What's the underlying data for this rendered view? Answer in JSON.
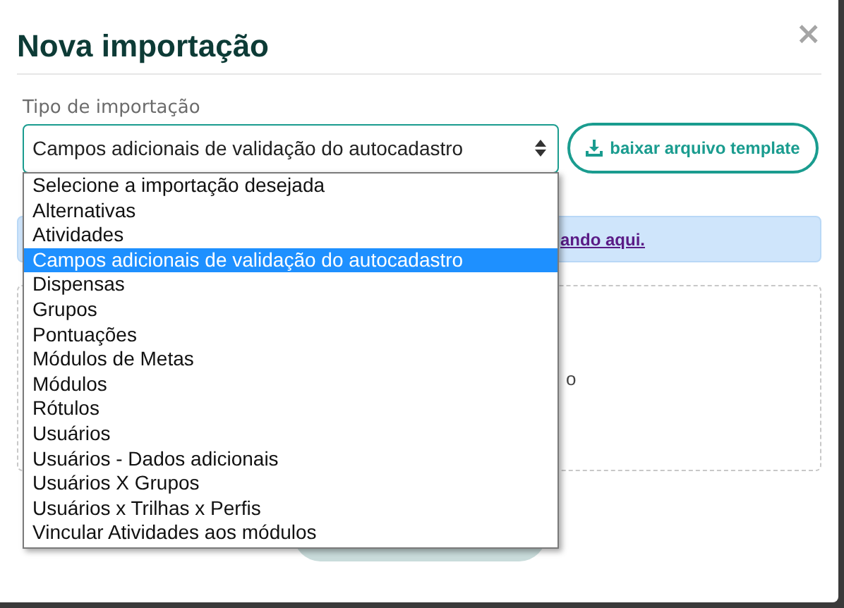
{
  "dialog": {
    "title": "Nova importação",
    "close": "×"
  },
  "import_type": {
    "label": "Tipo de importação",
    "value": "Campos adicionais de validação do autocadastro",
    "expanded": true
  },
  "template_button": {
    "label": "baixar arquivo template"
  },
  "options": [
    {
      "label": "Selecione a importação desejada",
      "selected": false
    },
    {
      "label": "Alternativas",
      "selected": false
    },
    {
      "label": "Atividades",
      "selected": false
    },
    {
      "label": "Campos adicionais de validação do autocadastro",
      "selected": true
    },
    {
      "label": "Dispensas",
      "selected": false
    },
    {
      "label": "Grupos",
      "selected": false
    },
    {
      "label": "Pontuações",
      "selected": false
    },
    {
      "label": "Módulos de Metas",
      "selected": false
    },
    {
      "label": "Módulos",
      "selected": false
    },
    {
      "label": "Rótulos",
      "selected": false
    },
    {
      "label": "Usuários",
      "selected": false
    },
    {
      "label": "Usuários - Dados adicionais",
      "selected": false
    },
    {
      "label": "Usuários X Grupos",
      "selected": false
    },
    {
      "label": "Usuários x Trilhas x Perfis",
      "selected": false
    },
    {
      "label": "Vincular Atividades aos módulos",
      "selected": false
    }
  ],
  "alert": {
    "link": "ando aqui."
  },
  "dropzone": {
    "text": "o"
  },
  "start_button": {
    "disabled": true
  }
}
